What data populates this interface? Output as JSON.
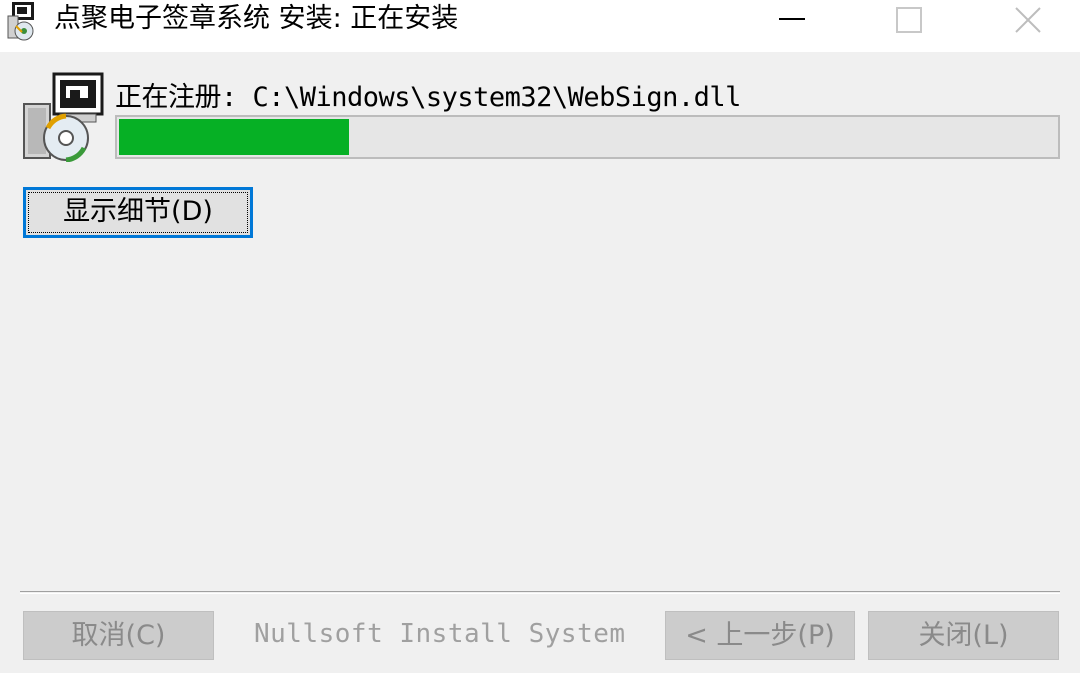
{
  "window": {
    "title": "点聚电子签章系统 安装: 正在安装"
  },
  "titlebar_icons": {
    "app": "installer-icon",
    "minimize": "minimize-icon",
    "maximize": "maximize-icon",
    "close": "close-icon"
  },
  "status": {
    "text": "正在注册: C:\\Windows\\system32\\WebSign.dll"
  },
  "progress": {
    "fraction": 0.245,
    "color": "#06b025"
  },
  "buttons": {
    "show_details": "显示细节(D)",
    "cancel": "取消(C)",
    "back": "< 上一步(P)",
    "close": "关闭(L)"
  },
  "footer": {
    "branding": "Nullsoft Install System"
  },
  "colors": {
    "accent": "#0078d7",
    "background": "#f0f0f0"
  }
}
